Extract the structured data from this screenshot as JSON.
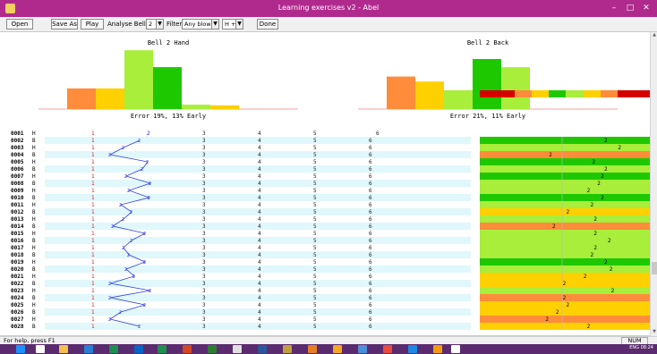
{
  "window": {
    "title": "Learning exercises v2 - Abel",
    "minimize": "–",
    "maximize": "□",
    "close": "✕"
  },
  "toolbar": {
    "open": "Open",
    "save_as": "Save As",
    "play": "Play",
    "analyse_bell_label": "Analyse Bell",
    "analyse_bell_value": "2",
    "filter_label": "Filter:",
    "filter_value": "Any blow",
    "h_b_value": "H + B",
    "done": "Done"
  },
  "charts": [
    {
      "title": "Bell 2 Hand",
      "footer": "Error 19%, 13% Early",
      "values": [
        0,
        0.33,
        0.33,
        0.94,
        0.67,
        0.07,
        0.06,
        0,
        0
      ],
      "colors": [
        "#ff8c3a",
        "#ff8c3a",
        "#ffd000",
        "#a8ee3a",
        "#1ec800",
        "#a8ee3a",
        "#ffd000",
        "#ff8c3a",
        "#d40000"
      ]
    },
    {
      "title": "Bell 2 Back",
      "footer": "Error 21%, 11% Early",
      "values": [
        0,
        0.52,
        0.44,
        0.3,
        0.8,
        0.67,
        0,
        0,
        0
      ],
      "colors": [
        "#ff8c3a",
        "#ff8c3a",
        "#ffd000",
        "#a8ee3a",
        "#1ec800",
        "#a8ee3a",
        "#ffd000",
        "#ff8c3a",
        "#d40000"
      ]
    }
  ],
  "color_key": [
    "#d40000",
    "#d40000",
    "#ff8c3a",
    "#ffd000",
    "#1ec800",
    "#a8ee3a",
    "#ffd000",
    "#ff8c3a",
    "#d40000",
    "#d40000"
  ],
  "header_row": {
    "id": "0001",
    "hb": "H",
    "bells": [
      "1",
      "2",
      "3",
      "4",
      "5",
      "6"
    ]
  },
  "row_bells": [
    "1",
    "2",
    "3",
    "4",
    "5",
    "6"
  ],
  "rows": [
    {
      "id": "0002",
      "hb": "B",
      "b2": 0.6,
      "err": 0.72,
      "color": "#1ec800"
    },
    {
      "id": "0003",
      "hb": "H",
      "b2": 0.3,
      "err": 0.8,
      "color": "#a8ee3a"
    },
    {
      "id": "0004",
      "hb": "B",
      "b2": 0.05,
      "err": 0.4,
      "color": "#ff8c3a"
    },
    {
      "id": "0005",
      "hb": "H",
      "b2": 0.75,
      "err": 0.65,
      "color": "#1ec800"
    },
    {
      "id": "0006",
      "hb": "B",
      "b2": 0.65,
      "err": 0.72,
      "color": "#a8ee3a"
    },
    {
      "id": "0007",
      "hb": "H",
      "b2": 0.35,
      "err": 0.7,
      "color": "#1ec800"
    },
    {
      "id": "0008",
      "hb": "B",
      "b2": 0.8,
      "err": 0.68,
      "color": "#a8ee3a"
    },
    {
      "id": "0009",
      "hb": "H",
      "b2": 0.4,
      "err": 0.62,
      "color": "#a8ee3a"
    },
    {
      "id": "0010",
      "hb": "B",
      "b2": 0.78,
      "err": 0.7,
      "color": "#1ec800"
    },
    {
      "id": "0011",
      "hb": "H",
      "b2": 0.25,
      "err": 0.64,
      "color": "#a8ee3a"
    },
    {
      "id": "0012",
      "hb": "B",
      "b2": 0.45,
      "err": 0.5,
      "color": "#ffd000"
    },
    {
      "id": "0013",
      "hb": "H",
      "b2": 0.3,
      "err": 0.66,
      "color": "#a8ee3a"
    },
    {
      "id": "0014",
      "hb": "B",
      "b2": 0.1,
      "err": 0.42,
      "color": "#ff8c3a"
    },
    {
      "id": "0015",
      "hb": "H",
      "b2": 0.7,
      "err": 0.66,
      "color": "#a8ee3a"
    },
    {
      "id": "0016",
      "hb": "B",
      "b2": 0.45,
      "err": 0.74,
      "color": "#a8ee3a"
    },
    {
      "id": "0017",
      "hb": "H",
      "b2": 0.3,
      "err": 0.66,
      "color": "#a8ee3a"
    },
    {
      "id": "0018",
      "hb": "B",
      "b2": 0.4,
      "err": 0.64,
      "color": "#a8ee3a"
    },
    {
      "id": "0019",
      "hb": "H",
      "b2": 0.7,
      "err": 0.72,
      "color": "#1ec800"
    },
    {
      "id": "0020",
      "hb": "B",
      "b2": 0.35,
      "err": 0.75,
      "color": "#a8ee3a"
    },
    {
      "id": "0021",
      "hb": "H",
      "b2": 0.5,
      "err": 0.6,
      "color": "#ffd000"
    },
    {
      "id": "0022",
      "hb": "B",
      "b2": 0.05,
      "err": 0.48,
      "color": "#ffd000"
    },
    {
      "id": "0023",
      "hb": "H",
      "b2": 0.8,
      "err": 0.76,
      "color": "#a8ee3a"
    },
    {
      "id": "0024",
      "hb": "B",
      "b2": 0.05,
      "err": 0.48,
      "color": "#ff8c3a"
    },
    {
      "id": "0025",
      "hb": "H",
      "b2": 0.7,
      "err": 0.5,
      "color": "#ffd000"
    },
    {
      "id": "0026",
      "hb": "B",
      "b2": 0.25,
      "err": 0.44,
      "color": "#ffd000"
    },
    {
      "id": "0027",
      "hb": "H",
      "b2": 0.05,
      "err": 0.38,
      "color": "#ff8c3a"
    },
    {
      "id": "0028",
      "hb": "B",
      "b2": 0.6,
      "err": 0.62,
      "color": "#ffd000"
    }
  ],
  "err_label": "2",
  "status": {
    "help": "For help, press F1",
    "num": "NUM"
  },
  "tray": {
    "lang": "ENG",
    "time": "08:24"
  }
}
